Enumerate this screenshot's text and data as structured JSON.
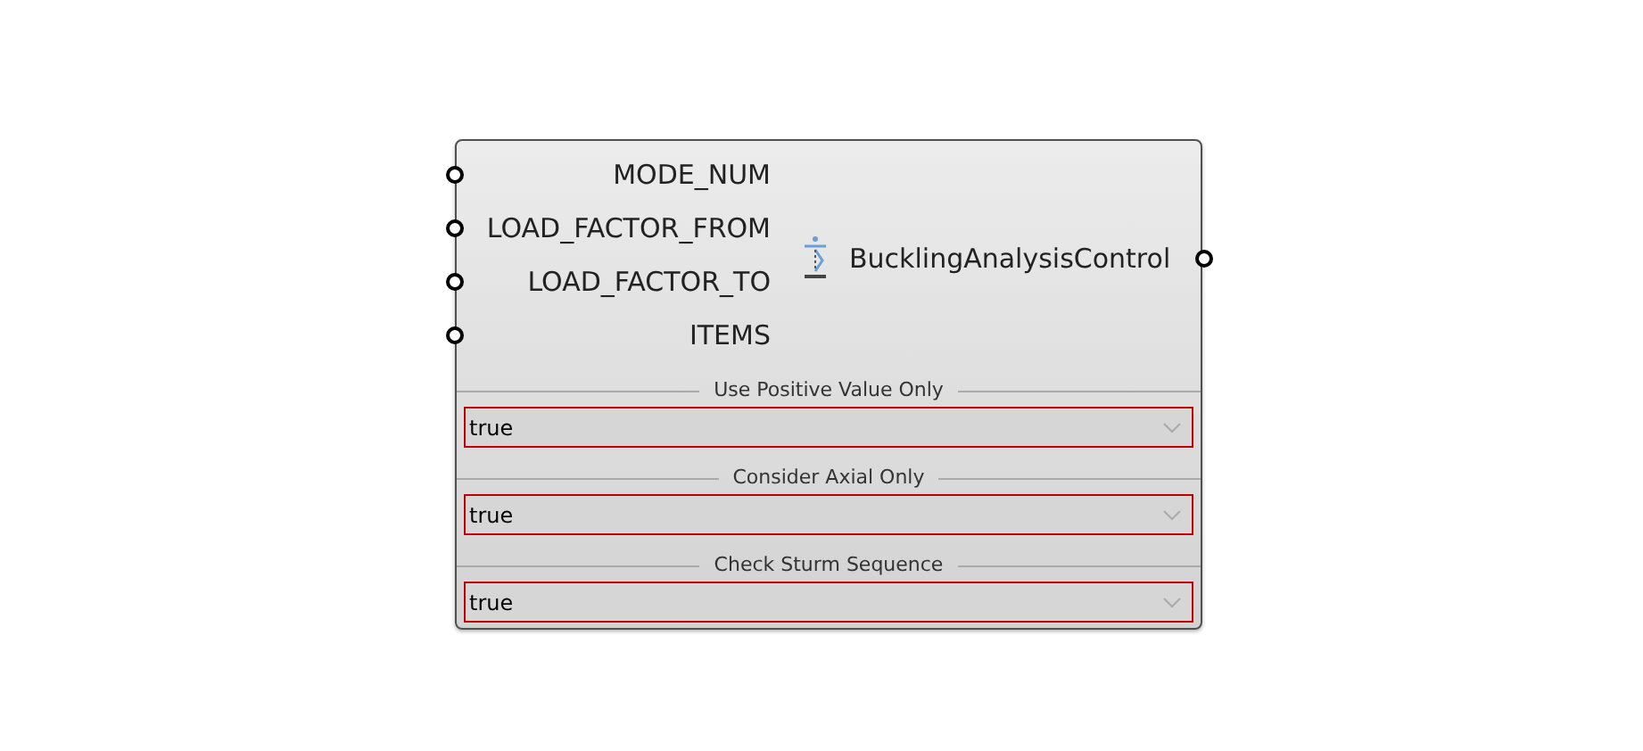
{
  "component": {
    "title": "BucklingAnalysisControl",
    "inputs": [
      {
        "label": "MODE_NUM"
      },
      {
        "label": "LOAD_FACTOR_FROM"
      },
      {
        "label": "LOAD_FACTOR_TO"
      },
      {
        "label": "ITEMS"
      }
    ],
    "options": [
      {
        "label": "Use Positive Value Only",
        "value": "true"
      },
      {
        "label": "Consider Axial Only",
        "value": "true"
      },
      {
        "label": "Check Sturm Sequence",
        "value": "true"
      }
    ]
  }
}
